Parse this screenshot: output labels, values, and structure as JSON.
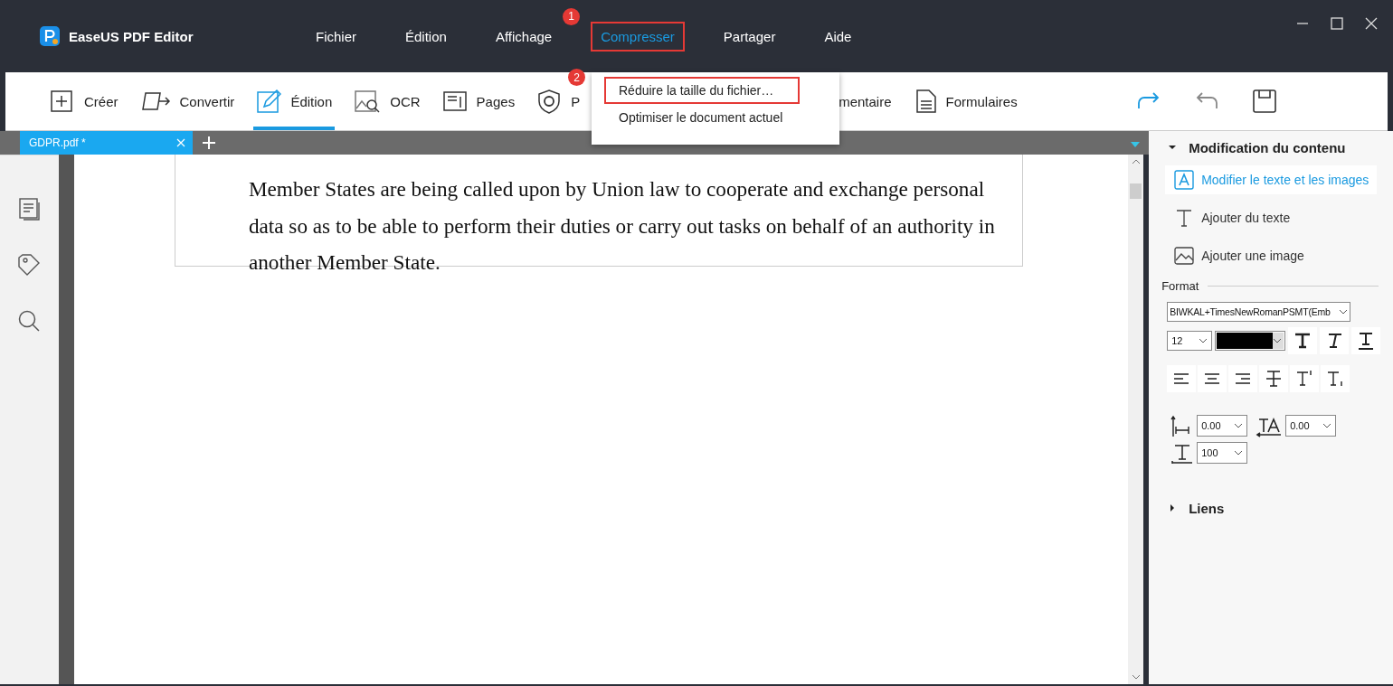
{
  "app": {
    "title": "EaseUS PDF Editor"
  },
  "menu": [
    {
      "label": "Fichier",
      "selected": false,
      "highlighted": false
    },
    {
      "label": "Édition",
      "selected": false,
      "highlighted": false
    },
    {
      "label": "Affichage",
      "selected": false,
      "highlighted": false
    },
    {
      "label": "Compresser",
      "selected": true,
      "highlighted": true,
      "badge": "1"
    },
    {
      "label": "Partager",
      "selected": false,
      "highlighted": false
    },
    {
      "label": "Aide",
      "selected": false,
      "highlighted": false
    }
  ],
  "dropdown": {
    "badge": "2",
    "items": [
      {
        "label": "Réduire la taille du fichier…",
        "highlighted": true
      },
      {
        "label": "Optimiser le document actuel",
        "highlighted": false
      }
    ]
  },
  "toolbar": [
    {
      "label": "Créer",
      "selected": false
    },
    {
      "label": "Convertir",
      "selected": false
    },
    {
      "label": "Édition",
      "selected": true
    },
    {
      "label": "OCR",
      "selected": false
    },
    {
      "label": "Pages",
      "selected": false
    },
    {
      "label": "P",
      "selected": false
    },
    {
      "label": "mentaire",
      "selected": false
    },
    {
      "label": "Formulaires",
      "selected": false
    }
  ],
  "tabs": [
    {
      "label": "GDPR.pdf *",
      "selected": true
    }
  ],
  "document": {
    "text": "Member States are being called upon by Union law to cooperate and exchange personal data so as to be able to perform their duties or carry out tasks on behalf of an authority in another Member State."
  },
  "panel": {
    "content_section": {
      "title": "Modification du contenu",
      "expanded": true,
      "items": [
        {
          "label": "Modifier le texte et les images",
          "selected": true
        },
        {
          "label": "Ajouter du texte",
          "selected": false
        },
        {
          "label": "Ajouter une image",
          "selected": false
        }
      ]
    },
    "format": {
      "label": "Format",
      "font": "BIWKAL+TimesNewRomanPSMT(Emb",
      "size": "12",
      "char_spacing": "0.00",
      "word_spacing": "0.00",
      "scale": "100"
    },
    "links_section": {
      "title": "Liens",
      "expanded": false
    }
  }
}
